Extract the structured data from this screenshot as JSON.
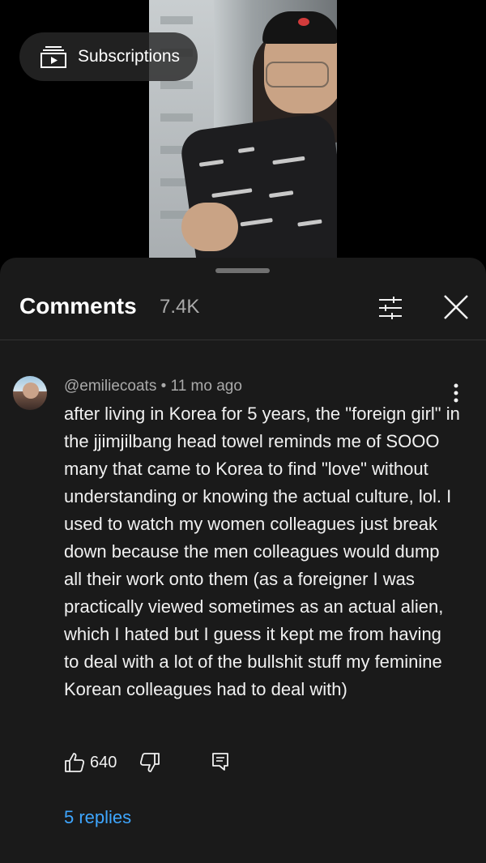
{
  "overlay": {
    "subscriptions_label": "Subscriptions"
  },
  "comments_panel": {
    "title": "Comments",
    "count": "7.4K"
  },
  "comment": {
    "author": "@emiliecoats",
    "separator": "•",
    "time": "11 mo ago",
    "meta": "@emiliecoats • 11 mo ago",
    "text": "after living in Korea for 5 years, the \"foreign girl\" in the jjimjilbang head towel reminds me of SOOO many that came to Korea to find \"love\" without understanding or knowing the actual culture, lol. I used to watch my women colleagues just break down because the men colleagues would dump all their work onto them (as a foreigner I was practically viewed sometimes as an actual alien, which I hated but I guess it kept me from having to deal with a lot of the bullshit stuff my feminine Korean colleagues had to deal with)",
    "likes": "640",
    "replies_label": "5 replies"
  },
  "icons": {
    "subscriptions": "subscriptions-icon",
    "filter": "sliders-icon",
    "close": "close-icon",
    "more": "more-vert-icon",
    "like": "thumb-up-icon",
    "dislike": "thumb-down-icon",
    "reply": "comment-reply-icon"
  },
  "colors": {
    "background": "#000000",
    "sheet": "#1a1a1a",
    "text": "#f1f1f1",
    "secondary_text": "#aaaaaa",
    "link": "#3ea6ff"
  }
}
